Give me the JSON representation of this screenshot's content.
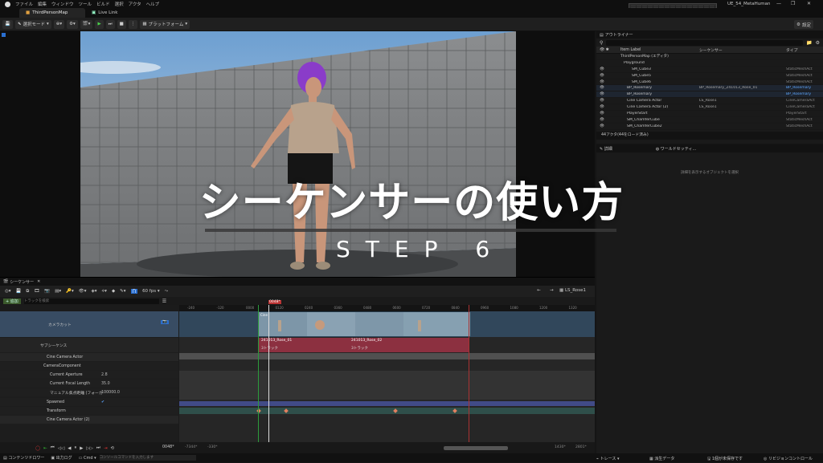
{
  "menu": [
    "ファイル",
    "編集",
    "ウィンドウ",
    "ツール",
    "ビルド",
    "選択",
    "アクタ",
    "ヘルプ"
  ],
  "window_title": "UE_54_MetaHuman",
  "tabs": [
    {
      "label": "ThirdPersonMap",
      "active": true
    },
    {
      "label": "Live Link",
      "active": false
    }
  ],
  "toolbar": {
    "mode": "選択モード",
    "platform": "プラットフォーム",
    "settings": "設定"
  },
  "overlay": {
    "title": "シーケンサーの使い方",
    "step": "STEP 6"
  },
  "outliner": {
    "title": "アウトライナー",
    "columns": [
      "Item Label",
      "シーケンサー",
      "タイプ"
    ],
    "rows": [
      {
        "label": "ThirdPersonMap (エディタ)",
        "seq": "",
        "type": ""
      },
      {
        "label": "Playground",
        "seq": "",
        "type": ""
      },
      {
        "label": "SM_Cube3",
        "seq": "",
        "type": "StaticMeshAct"
      },
      {
        "label": "SM_Cube5",
        "seq": "",
        "type": "StaticMeshAct"
      },
      {
        "label": "SM_Cube6",
        "seq": "",
        "type": "StaticMeshAct"
      },
      {
        "label": "BP_Rosemary",
        "seq": "BP_Rosemary_241013_Rose_01",
        "type": "BP_Rosemary"
      },
      {
        "label": "BP_Rosemary",
        "seq": "",
        "type": "BP_Rosemary"
      },
      {
        "label": "Cine Camera Actor",
        "seq": "LS_Rose1",
        "type": "CineCameraAct"
      },
      {
        "label": "Cine Camera Actor (2)",
        "seq": "LS_Rose1",
        "type": "CineCameraAct"
      },
      {
        "label": "PlayerStart",
        "seq": "",
        "type": "PlayerStart"
      },
      {
        "label": "SM_ChamferCube",
        "seq": "",
        "type": "StaticMeshAct"
      },
      {
        "label": "SM_ChamferCube2",
        "seq": "",
        "type": "StaticMeshAct"
      }
    ],
    "count": "44アクタ(44をロード済み)"
  },
  "details": {
    "tab": "詳細",
    "world": "ワールドセッティ...",
    "empty": "詳細を表示するオブジェクトを選択"
  },
  "sequencer": {
    "tab": "シーケンサー",
    "fps": "60 fps",
    "sequence_name": "LS_Rose1",
    "add": "+ 追加",
    "search_placeholder": "トラックを検索",
    "current_frame": "0048*",
    "tracks": [
      {
        "label": "カメラカット"
      },
      {
        "label": "サブシーケンス"
      },
      {
        "label": "Cine Camera Actor"
      },
      {
        "label": "CameraComponent"
      },
      {
        "label": "Current Aperture",
        "value": "2.8"
      },
      {
        "label": "Current Focal Length",
        "value": "35.0"
      },
      {
        "label": "マニュアル焦点距離 (フォーカ",
        "value": "100000.0"
      },
      {
        "label": "Spawned"
      },
      {
        "label": "Transform"
      },
      {
        "label": "Cine Camera Actor (2)"
      }
    ],
    "ruler": [
      "-240",
      "-120",
      "0000",
      "0120",
      "0240",
      "0360",
      "0480",
      "0600",
      "0720",
      "0840",
      "0960",
      "1080",
      "1200",
      "1320"
    ],
    "clips": [
      {
        "label": "241013_Rose_01",
        "sub": "3トラック"
      },
      {
        "label": "241013_Rose_02",
        "sub": "3トラック"
      }
    ],
    "camera_clip_label": "Cine",
    "bottom": {
      "frame": "0048*",
      "start": "-7344*",
      "start2": "-330*",
      "end": "1430*",
      "end2": "2801*"
    }
  },
  "statusbar": {
    "content": "コンテンツドロワー",
    "output": "出力ログ",
    "cmd": "Cmd",
    "cmd_placeholder": "コンソールコマンドを入力します",
    "trace": "トレース",
    "derived": "派生データ",
    "unsaved": "1個が未保存です",
    "revision": "リビジョンコントロール"
  },
  "colors": {
    "accent": "#2a6fd0",
    "selection": "#3a5a78",
    "subseq": "#8c3040",
    "camera_row": "#384c63"
  }
}
